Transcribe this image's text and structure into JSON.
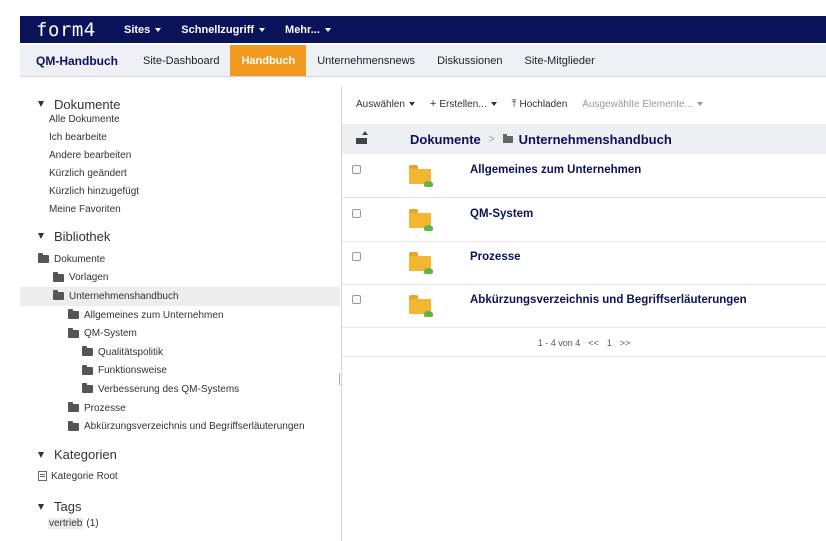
{
  "app": {
    "logo": "form4",
    "nav": [
      {
        "label": "Sites"
      },
      {
        "label": "Schnellzugriff"
      },
      {
        "label": "Mehr..."
      }
    ]
  },
  "site": {
    "title": "QM-Handbuch",
    "tabs": [
      {
        "label": "Site-Dashboard"
      },
      {
        "label": "Handbuch",
        "active": true
      },
      {
        "label": "Unternehmensnews"
      },
      {
        "label": "Diskussionen"
      },
      {
        "label": "Site-Mitglieder"
      }
    ]
  },
  "sidebar": {
    "documents": {
      "title": "Dokumente",
      "links": [
        "Alle Dokumente",
        "Ich bearbeite",
        "Andere bearbeiten",
        "Kürzlich geändert",
        "Kürzlich hinzugefügt",
        "Meine Favoriten"
      ]
    },
    "library": {
      "title": "Bibliothek",
      "tree": [
        {
          "label": "Dokumente",
          "level": 0
        },
        {
          "label": "Vorlagen",
          "level": 1
        },
        {
          "label": "Unternehmenshandbuch",
          "level": 1,
          "selected": true
        },
        {
          "label": "Allgemeines zum Unternehmen",
          "level": 2
        },
        {
          "label": "QM-System",
          "level": 2
        },
        {
          "label": "Qualitätspolitik",
          "level": 3
        },
        {
          "label": "Funktionsweise",
          "level": 3
        },
        {
          "label": "Verbesserung des QM-Systems",
          "level": 3
        },
        {
          "label": "Prozesse",
          "level": 2
        },
        {
          "label": "Abkürzungsverzeichnis und Begriffserläuterungen",
          "level": 2
        }
      ]
    },
    "categories": {
      "title": "Kategorien",
      "root": "Kategorie Root"
    },
    "tags": {
      "title": "Tags",
      "items": [
        {
          "label": "vertrieb",
          "count": "(1)"
        }
      ]
    }
  },
  "toolbar": {
    "select": "Auswählen",
    "create": "Erstellen...",
    "upload": "Hochladen",
    "selected_items": "Ausgewählte Elemente..."
  },
  "breadcrumb": {
    "root": "Dokumente",
    "separator": ">",
    "current": "Unternehmenshandbuch"
  },
  "documents": [
    {
      "title": "Allgemeines zum Unternehmen"
    },
    {
      "title": "QM-System"
    },
    {
      "title": "Prozesse"
    },
    {
      "title": "Abkürzungsverzeichnis und Begriffserläuterungen"
    }
  ],
  "pager": {
    "range": "1 - 4 von 4",
    "prev": "<<",
    "page": "1",
    "next": ">>"
  },
  "colors": {
    "header": "#0a1259",
    "active_tab": "#f29a1f",
    "folder": "#f2b630",
    "folder_check": "#5db64b"
  }
}
